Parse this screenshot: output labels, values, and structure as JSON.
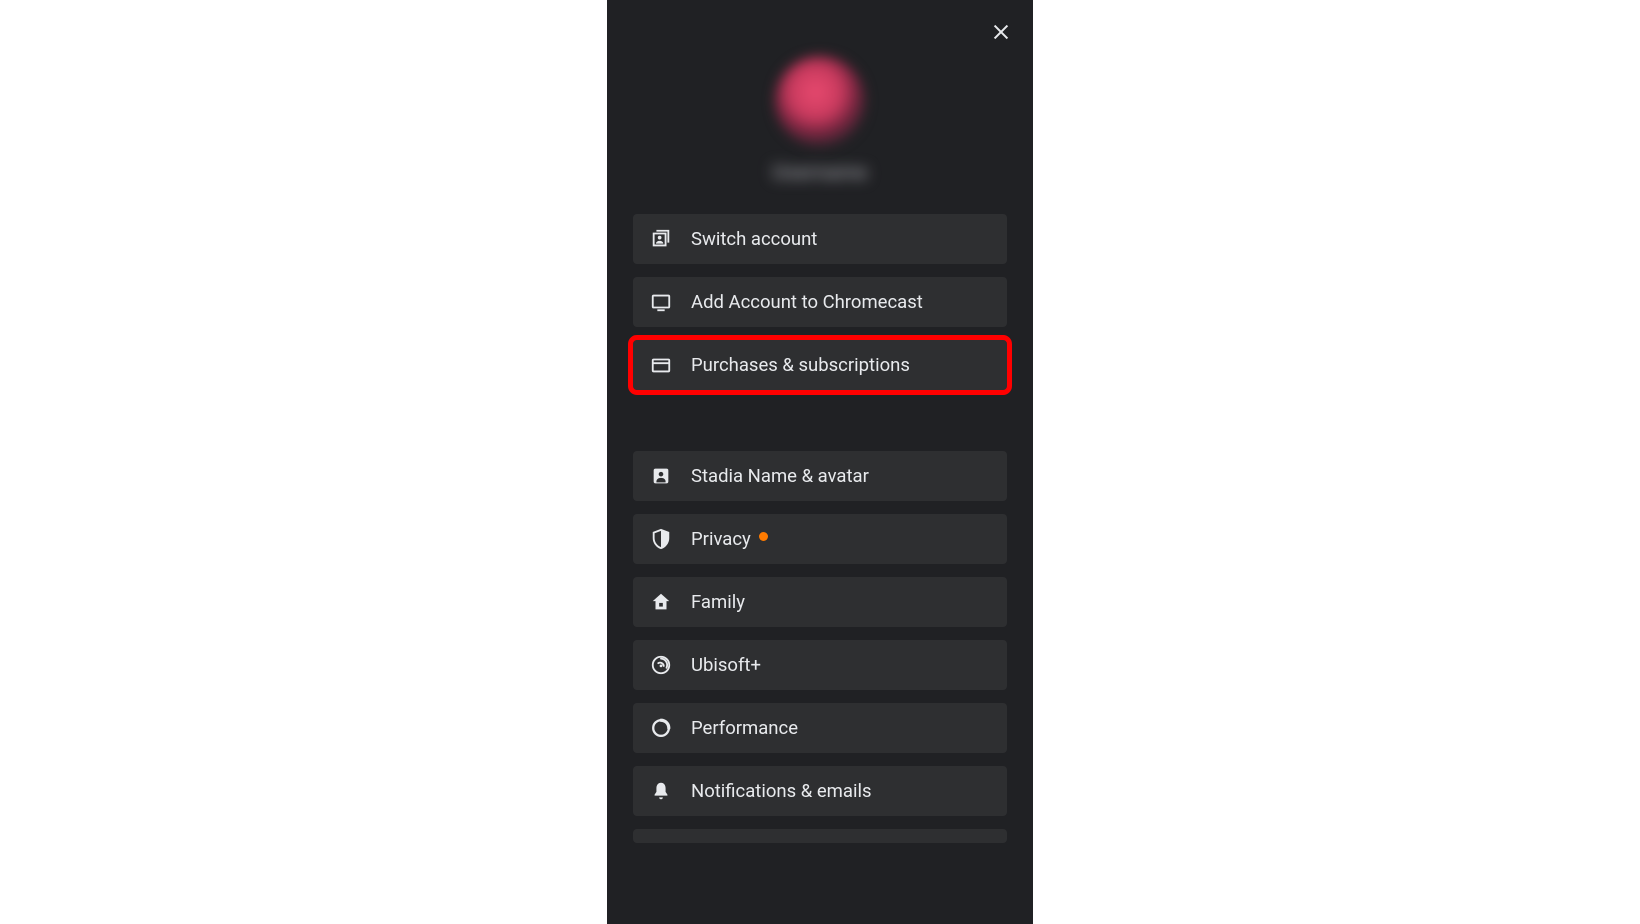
{
  "profile": {
    "username_blurred": "Username"
  },
  "menu": {
    "section1": [
      {
        "id": "switch-account",
        "label": "Switch account",
        "icon": "switch-account-icon",
        "highlighted": false,
        "badge": false
      },
      {
        "id": "add-chromecast",
        "label": "Add Account to Chromecast",
        "icon": "tv-icon",
        "highlighted": false,
        "badge": false
      },
      {
        "id": "purchases",
        "label": "Purchases & subscriptions",
        "icon": "card-icon",
        "highlighted": true,
        "badge": false
      }
    ],
    "section2": [
      {
        "id": "stadia-name",
        "label": "Stadia Name & avatar",
        "icon": "person-icon",
        "highlighted": false,
        "badge": false
      },
      {
        "id": "privacy",
        "label": "Privacy",
        "icon": "shield-icon",
        "highlighted": false,
        "badge": true
      },
      {
        "id": "family",
        "label": "Family",
        "icon": "home-icon",
        "highlighted": false,
        "badge": false
      },
      {
        "id": "ubisoft",
        "label": "Ubisoft+",
        "icon": "ubisoft-icon",
        "highlighted": false,
        "badge": false
      },
      {
        "id": "performance",
        "label": "Performance",
        "icon": "performance-icon",
        "highlighted": false,
        "badge": false
      },
      {
        "id": "notifications",
        "label": "Notifications & emails",
        "icon": "bell-icon",
        "highlighted": false,
        "badge": false
      }
    ]
  },
  "colors": {
    "panel_bg": "#202124",
    "item_bg": "#2e2f31",
    "text": "#e8eaed",
    "highlight": "#ff0000",
    "badge": "#ff7b00"
  }
}
